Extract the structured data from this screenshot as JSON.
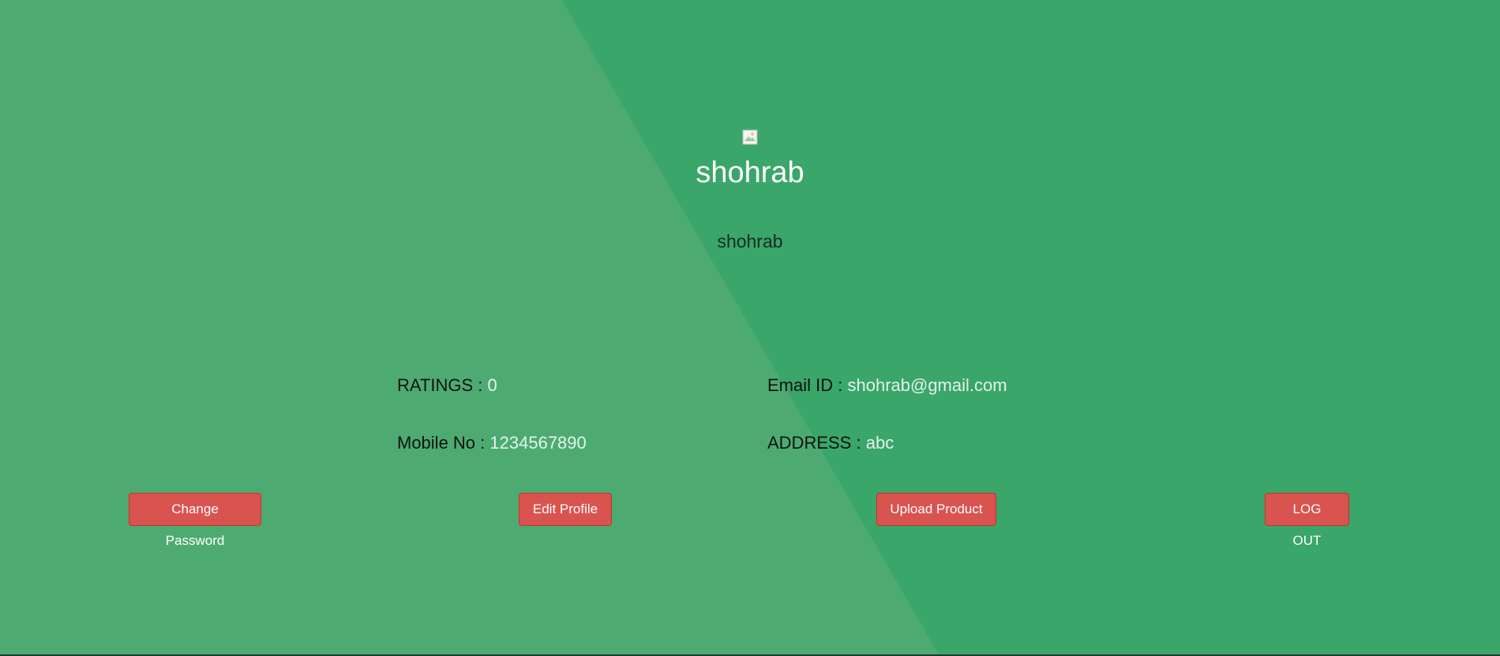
{
  "colors": {
    "background_left": "#4dab72",
    "background_right": "#3aa66a",
    "button": "#d9534f",
    "username": "#ffffff",
    "label": "#111111",
    "value": "#e3f3ea"
  },
  "profile": {
    "avatar_icon": "broken-image-icon",
    "name_heading": "shohrab",
    "name_sub": "shohrab"
  },
  "details": {
    "ratings_label": "RATINGS :",
    "ratings_value": "0",
    "email_label": "Email ID :",
    "email_value": "shohrab@gmail.com",
    "mobile_label": "Mobile No :",
    "mobile_value": "1234567890",
    "address_label": "ADDRESS :",
    "address_value": "abc"
  },
  "actions": {
    "change_password": "Change Password",
    "edit_profile": "Edit Profile",
    "upload_product": "Upload Product",
    "logout": "LOG OUT"
  }
}
